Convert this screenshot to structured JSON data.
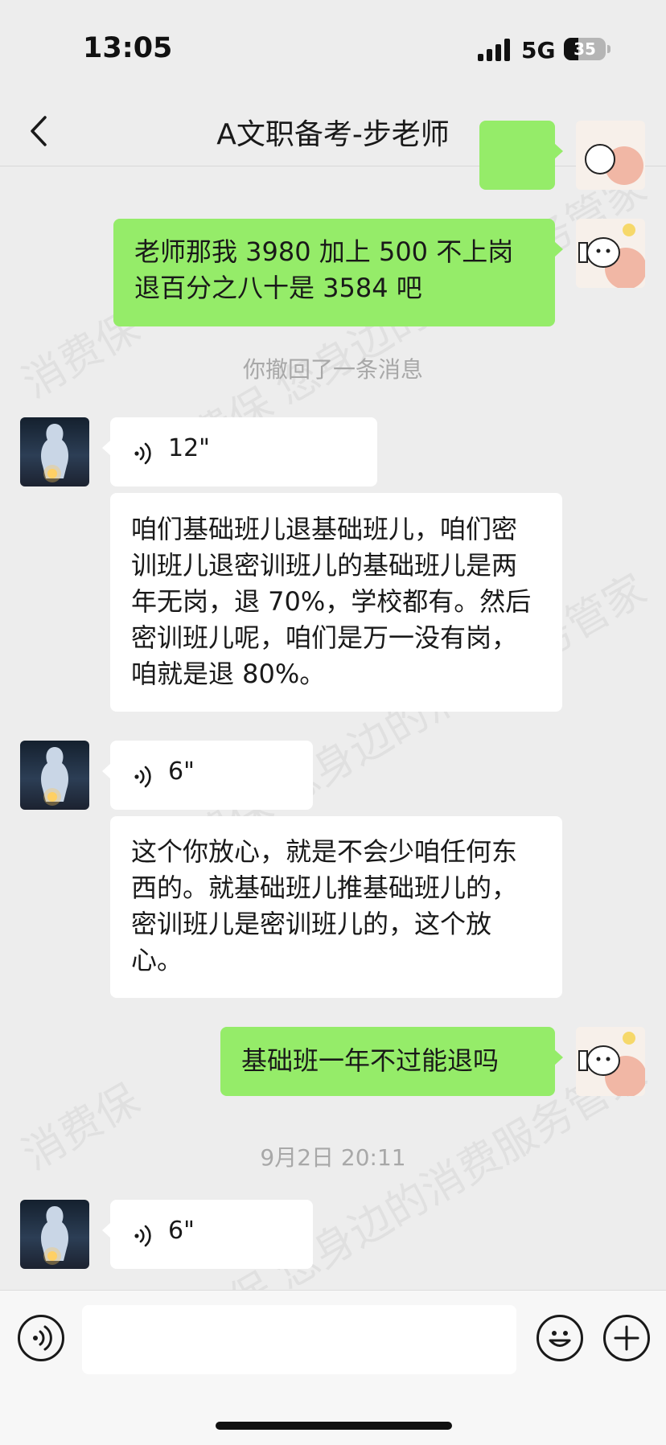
{
  "status_bar": {
    "time": "13:05",
    "network": "5G",
    "battery": "35",
    "battery_level": 0.35
  },
  "header": {
    "title": "A文职备考-步老师"
  },
  "messages": {
    "out_1_text": "老师那我 3980 加上 500 不上岗退百分之八十是 3584 吧",
    "recall_notice": "你撤回了一条消息",
    "voice_1_duration": "12\"",
    "in_1_text": "咱们基础班儿退基础班儿，咱们密训班儿退密训班儿的基础班儿是两年无岗，退 70%，学校都有。然后密训班儿呢，咱们是万一没有岗，咱就是退 80%。",
    "voice_2_duration": "6\"",
    "in_2_text": "这个你放心，就是不会少咱任何东西的。就基础班儿推基础班儿的，密训班儿是密训班儿的，这个放心。",
    "out_2_text": "基础班一年不过能退吗",
    "timestamp": "9月2日 20:11",
    "voice_3_duration": "6\""
  },
  "watermark": {
    "text_1": "消费保 您身边的消费服务管家",
    "text_2": "消费保"
  },
  "input_bar": {
    "value": ""
  },
  "colors": {
    "background": "#ededed",
    "outgoing_bubble": "#95ec69",
    "incoming_bubble": "#ffffff",
    "system_text": "#a8a8a8"
  },
  "icons": [
    "back-icon",
    "more-icon",
    "voice-icon",
    "emoji-icon",
    "plus-icon"
  ]
}
